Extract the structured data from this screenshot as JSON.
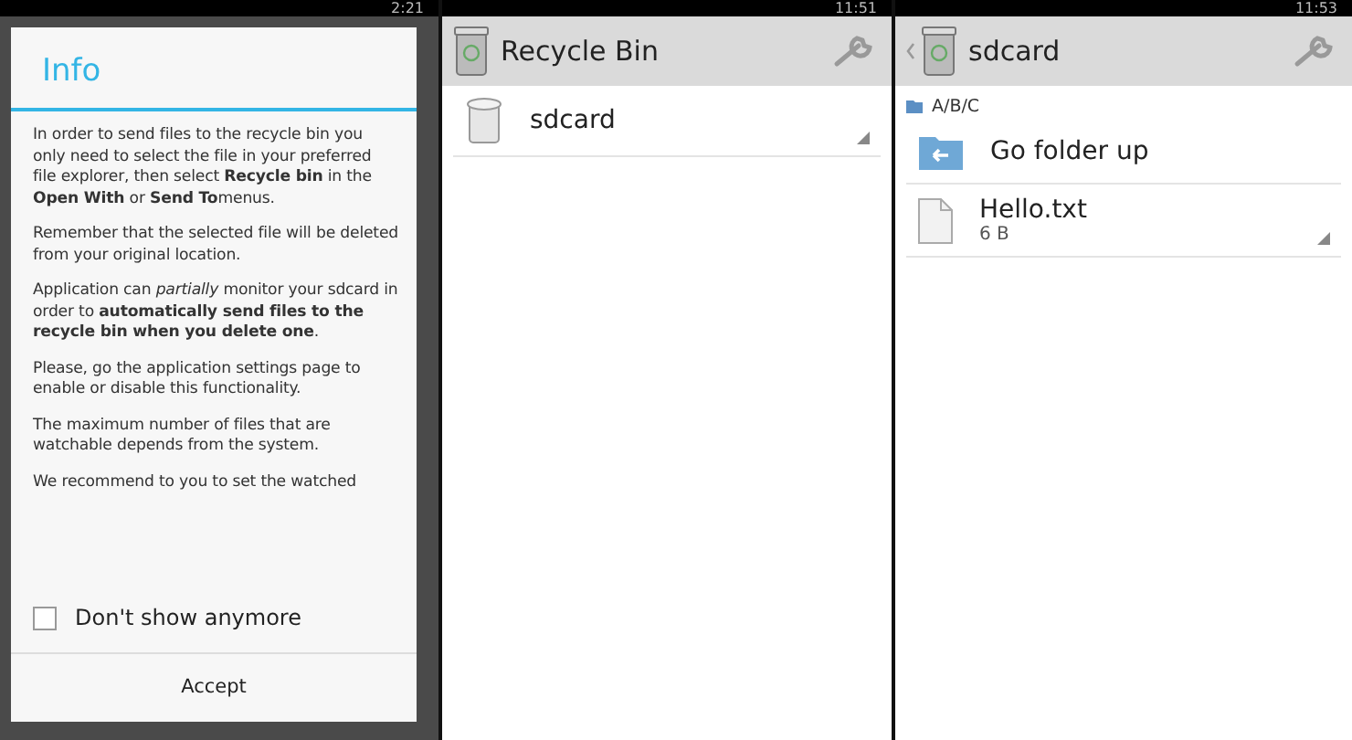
{
  "screens": [
    {
      "status_bar": {
        "time": "2:21"
      },
      "dialog": {
        "title": "Info",
        "paragraphs": [
          "In order to send files to the recycle bin you only need to select the file in your preferred file explorer, then select **Recycle bin** in the **Open With** or **Send To**menus.",
          "Remember that the selected file will be deleted from your original location.",
          "Application can *partially* monitor your sdcard in order to **automatically send files to the recycle bin when you delete one**.",
          "Please, go the application settings page to enable or disable this functionality.",
          "The maximum number of files that are watchable depends from the system.",
          "We recommend to you to set the watched"
        ],
        "checkbox": {
          "label": "Don't show anymore",
          "checked": false
        },
        "button": "Accept"
      }
    },
    {
      "status_bar": {
        "time": "11:51"
      },
      "action_bar": {
        "title": "Recycle Bin",
        "back": false
      },
      "items": [
        {
          "kind": "trash",
          "name": "sdcard"
        }
      ]
    },
    {
      "status_bar": {
        "time": "11:53"
      },
      "action_bar": {
        "title": "sdcard",
        "back": true
      },
      "path": "A/B/C",
      "items": [
        {
          "kind": "up",
          "name": "Go folder up"
        },
        {
          "kind": "file",
          "name": "Hello.txt",
          "size": "6 B"
        }
      ]
    }
  ]
}
